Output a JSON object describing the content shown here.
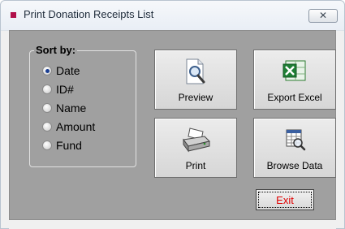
{
  "window": {
    "title": "Print Donation Receipts List",
    "close_label": "✕"
  },
  "sort": {
    "legend": "Sort by:",
    "options": [
      {
        "label": "Date",
        "checked": true
      },
      {
        "label": "ID#",
        "checked": false
      },
      {
        "label": "Name",
        "checked": false
      },
      {
        "label": "Amount",
        "checked": false
      },
      {
        "label": "Fund",
        "checked": false
      }
    ]
  },
  "buttons": {
    "preview": "Preview",
    "export_excel": "Export Excel",
    "print": "Print",
    "browse_data": "Browse Data",
    "exit": "Exit"
  },
  "icons": {
    "preview": "magnifier-document-icon",
    "export_excel": "excel-icon",
    "print": "printer-icon",
    "browse_data": "browse-grid-icon"
  },
  "colors": {
    "exit_text": "#e00000",
    "title_icon": "#b0104a",
    "client_bg": "#a0a0a0"
  }
}
